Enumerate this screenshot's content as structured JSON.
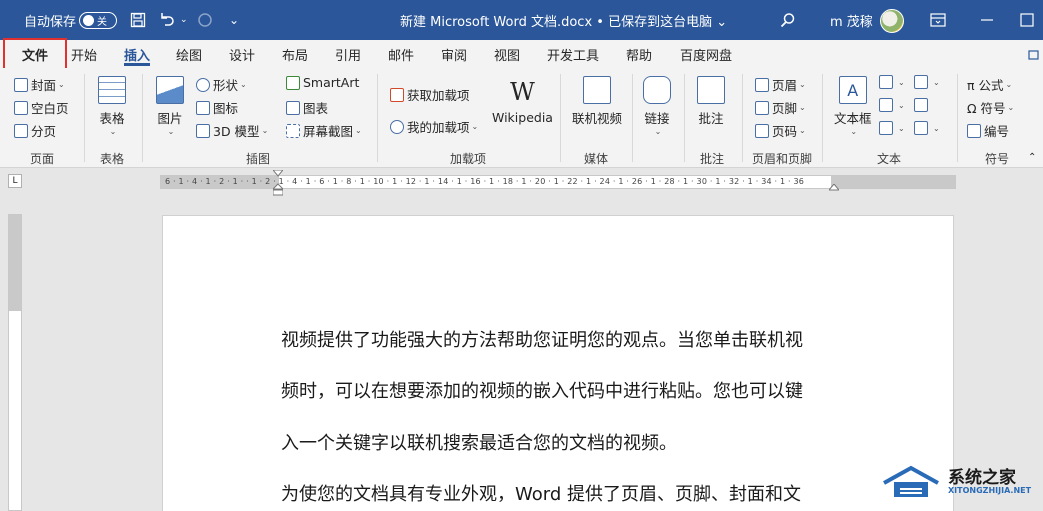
{
  "titlebar": {
    "autosave_label": "自动保存",
    "autosave_state": "关",
    "doc_title": "新建 Microsoft Word 文档.docx • 已保存到这台电脑 ⌄",
    "user_name": "m 茂稼"
  },
  "tabs": {
    "file": "文件",
    "items": [
      "开始",
      "插入",
      "绘图",
      "设计",
      "布局",
      "引用",
      "邮件",
      "审阅",
      "视图",
      "开发工具",
      "帮助",
      "百度网盘"
    ],
    "active": "插入"
  },
  "ribbon": {
    "pages": {
      "cover": "封面",
      "blank": "空白页",
      "break": "分页",
      "label": "页面"
    },
    "tables": {
      "table": "表格",
      "label": "表格"
    },
    "illustrations": {
      "picture": "图片",
      "shapes": "形状",
      "icons": "图标",
      "model3d": "3D 模型",
      "smartart": "SmartArt",
      "chart": "图表",
      "screenshot": "屏幕截图",
      "label": "插图"
    },
    "addins": {
      "get": "获取加载项",
      "mine": "我的加载项",
      "wikipedia": "Wikipedia",
      "label": "加载项"
    },
    "media": {
      "online_video": "联机视频",
      "label": "媒体"
    },
    "links": {
      "link": "链接"
    },
    "comments": {
      "comment": "批注",
      "label": "批注"
    },
    "header_footer": {
      "header": "页眉",
      "footer": "页脚",
      "page_number": "页码",
      "label": "页眉和页脚"
    },
    "text": {
      "textbox": "文本框",
      "label": "文本"
    },
    "symbols": {
      "equation": "π 公式",
      "symbol": "Ω 符号",
      "number": "编号",
      "label": "符号"
    }
  },
  "ruler": {
    "marks": "6 · 1 · 4 · 1 · 2 · 1 ·   · 1 · 2 · 1 · 4 · 1 · 6 · 1 · 8 · 1 · 10 · 1 · 12 · 1 · 14 · 1 · 16 · 1 · 18 · 1 · 20 · 1 · 22 · 1 · 24 · 1 · 26 · 1 · 28 · 1 · 30 · 1 · 32 · 1 · 34 · 1 · 36",
    "tab_selector": "L"
  },
  "document": {
    "lines": [
      "视频提供了功能强大的方法帮助您证明您的观点。当您单击联机视",
      "频时，可以在想要添加的视频的嵌入代码中进行粘贴。您也可以键",
      "入一个关键字以联机搜索最适合您的文档的视频。",
      "为使您的文档具有专业外观，Word 提供了页眉、页脚、封面和文"
    ]
  },
  "watermark": {
    "name": "系统之家",
    "url": "XITONGZHIJIA.NET"
  }
}
